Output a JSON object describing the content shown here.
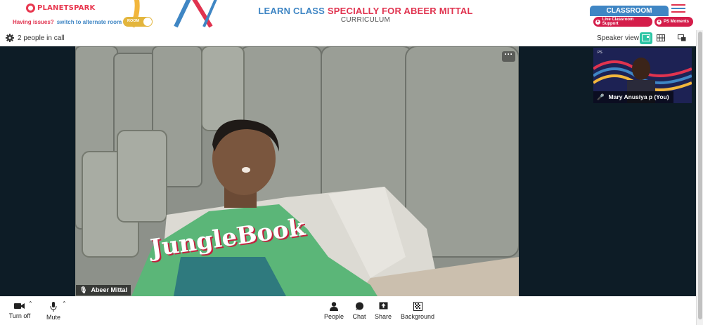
{
  "header": {
    "brand": "PLANETSPARK",
    "title_prefix": "LEARN CLASS ",
    "title_highlight": "SPECIALLY FOR ABEER MITTAL",
    "subtitle": "CURRICULUM",
    "issues_question": "Having issues?",
    "issues_link": "switch to alternate room",
    "toggle_label": "ROOM",
    "classroom_tab": "CLASSROOM",
    "support_pill": "Live Classroom Support",
    "moments_pill": "PS Moments",
    "colors": {
      "brand_red": "#e0334f",
      "brand_blue": "#3f86c4",
      "pill_red": "#d41d4a",
      "toggle_yellow": "#e3b53c"
    }
  },
  "call_bar": {
    "people_count": "2 people in call",
    "view_label": "Speaker view",
    "icons": [
      "settings-gear-icon",
      "speaker-view-icon",
      "grid-view-icon",
      "picture-in-picture-icon"
    ]
  },
  "main_video": {
    "participant": "Abeer Mittal",
    "mic_state": "muted",
    "shirt_text": "JungleBook"
  },
  "self_thumbnail": {
    "participant": "Mary Anusiya p (You)"
  },
  "footer": {
    "turn_off": "Turn off",
    "mute": "Mute",
    "people": "People",
    "chat": "Chat",
    "share": "Share",
    "background": "Background"
  }
}
